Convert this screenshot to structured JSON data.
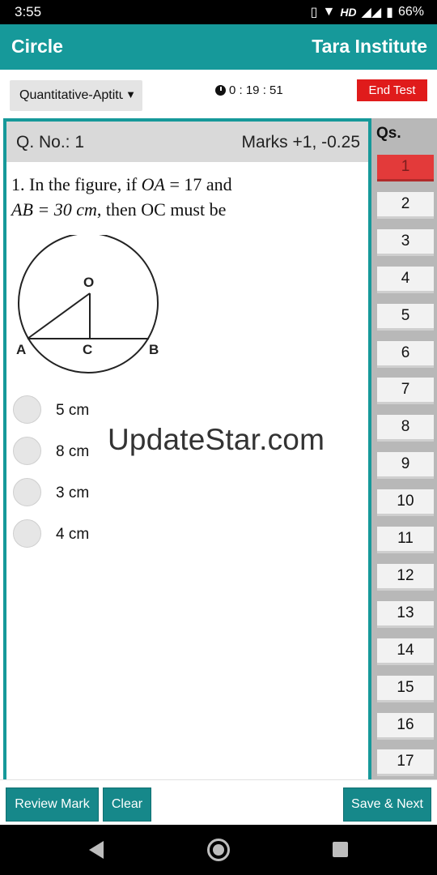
{
  "status_bar": {
    "time": "3:55",
    "network": "HD",
    "battery": "66%"
  },
  "app_bar": {
    "title": "Circle",
    "institute": "Tara Institute"
  },
  "controls": {
    "subject": "Quantitative-Aptitude",
    "timer": "0 : 19 : 51",
    "end_test_label": "End Test"
  },
  "question": {
    "number_label": "Q. No.: 1",
    "marks_label": "Marks +1, -0.25",
    "text_line1_pre": "1. In the figure, if ",
    "text_line1_math": "OA",
    "text_line1_eq": " = 17",
    "text_line1_post": "  and",
    "text_line2_math": "AB = 30 cm",
    "text_line2_post": ", then OC must be",
    "figure_labels": {
      "o": "O",
      "a": "A",
      "c": "C",
      "b": "B"
    },
    "options": [
      {
        "label": "5 cm"
      },
      {
        "label": "8 cm"
      },
      {
        "label": "3 cm"
      },
      {
        "label": "4 cm"
      }
    ]
  },
  "watermark": "UpdateStar.com",
  "qs_panel": {
    "title": "Qs.",
    "items": [
      "1",
      "2",
      "3",
      "4",
      "5",
      "6",
      "7",
      "8",
      "9",
      "10",
      "11",
      "12",
      "13",
      "14",
      "15",
      "16",
      "17"
    ],
    "active": "1"
  },
  "bottom_bar": {
    "review_label": "Review Mark",
    "clear_label": "Clear",
    "save_next_label": "Save & Next"
  },
  "colors": {
    "primary": "#16999a",
    "danger": "#e01b1b",
    "active_q": "#e33a3a"
  }
}
